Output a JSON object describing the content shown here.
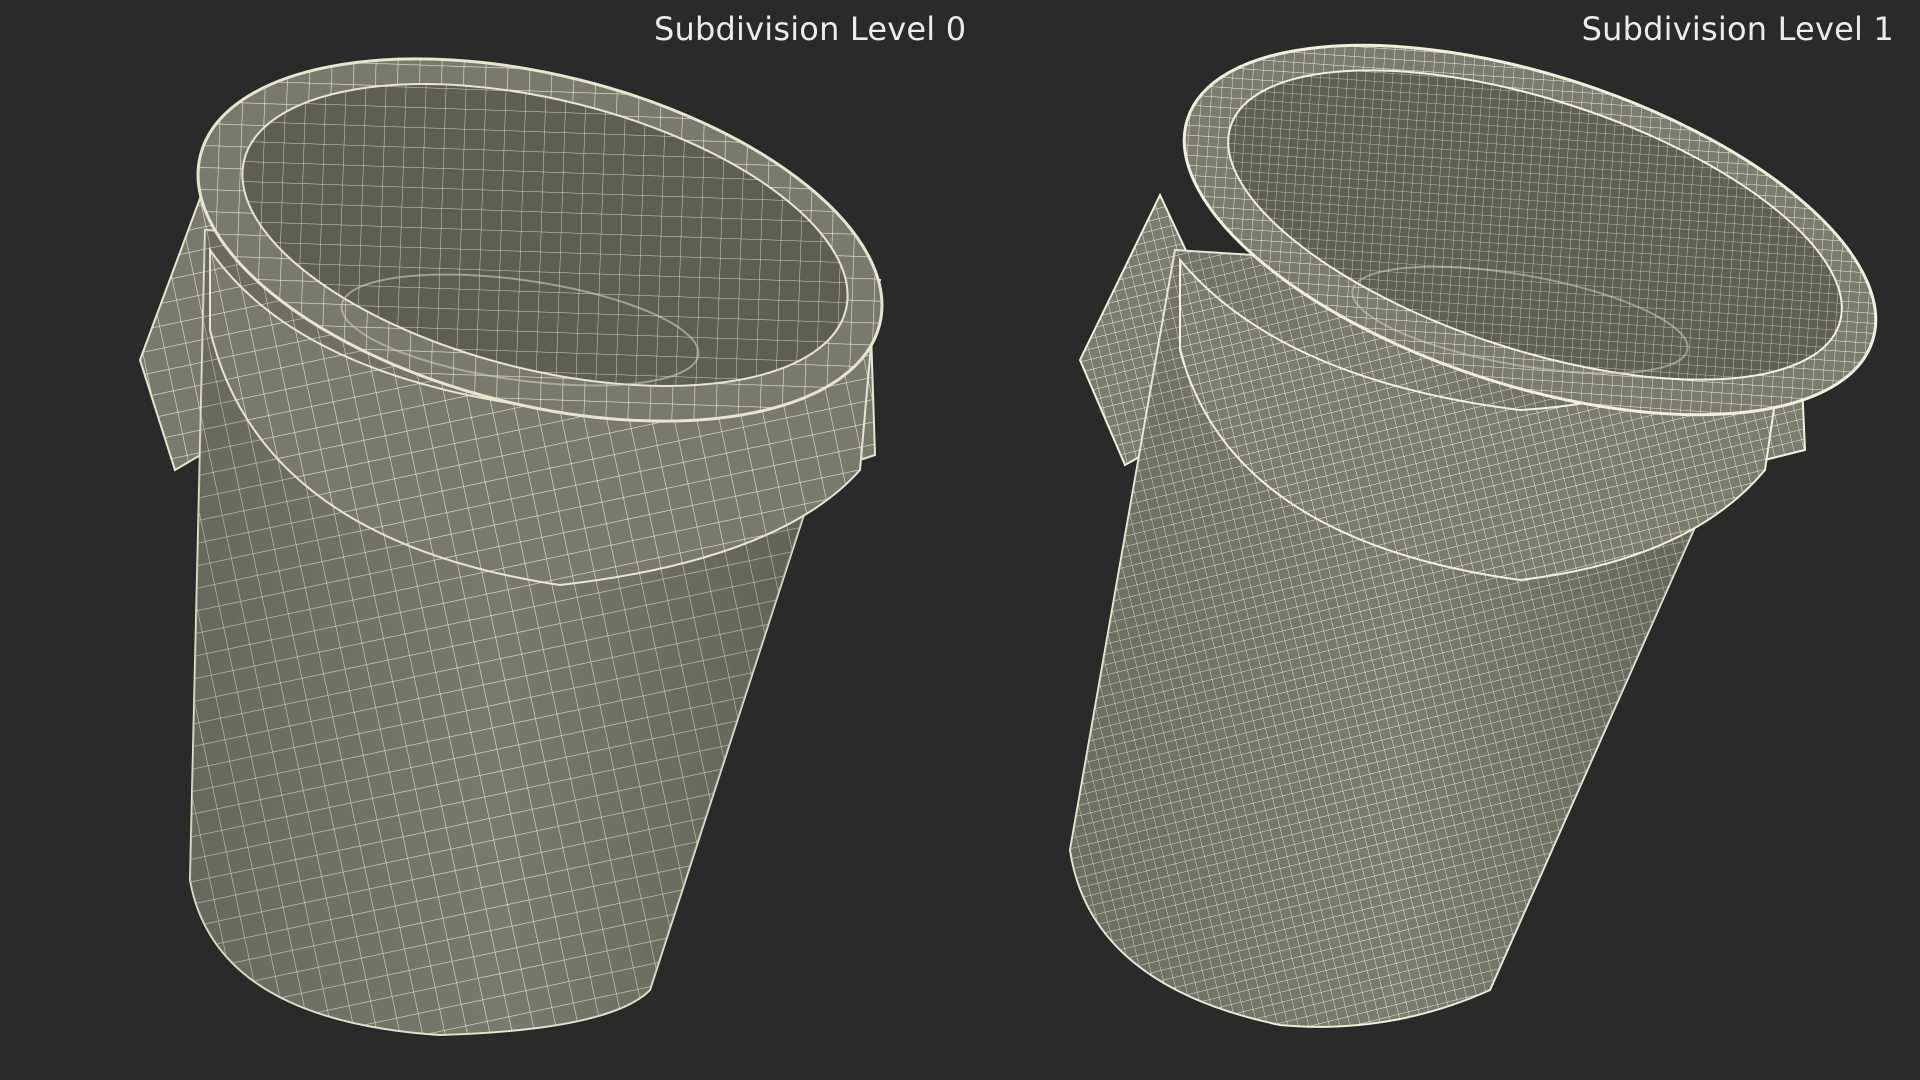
{
  "labels": {
    "left": "Subdivision Level 0",
    "right": "Subdivision Level 1"
  },
  "colors": {
    "background": "#2a2a2a",
    "mesh_surface": "#7a7a6c",
    "mesh_interior": "#5b5b50",
    "wire_level_0": "#e6e6d0",
    "wire_level_1": "#f0f0dc",
    "label_text": "#ececec"
  },
  "views": [
    {
      "name": "subdivision-level-0",
      "subdivision_level": 0
    },
    {
      "name": "subdivision-level-1",
      "subdivision_level": 1
    }
  ]
}
